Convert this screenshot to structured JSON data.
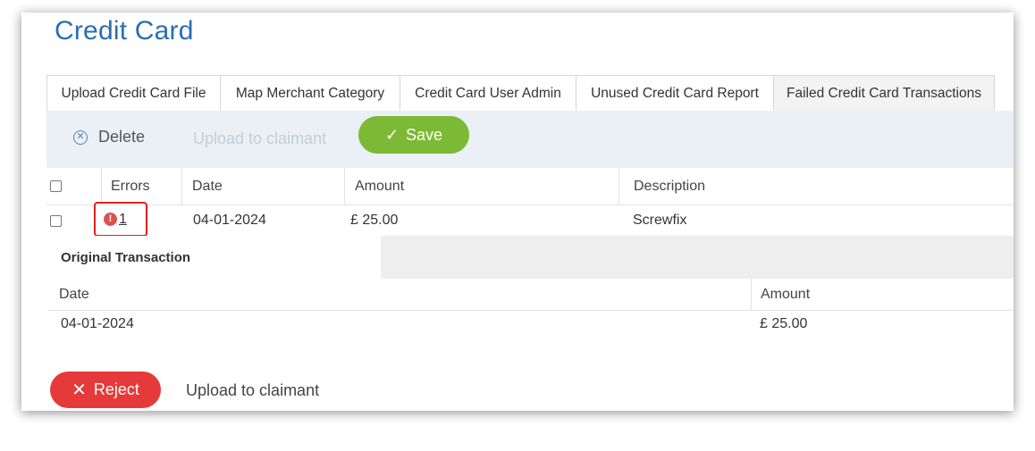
{
  "page": {
    "title": "Credit Card"
  },
  "tabs": [
    {
      "label": "Upload Credit Card File"
    },
    {
      "label": "Map Merchant Category"
    },
    {
      "label": "Credit Card User Admin"
    },
    {
      "label": "Unused Credit Card Report"
    },
    {
      "label": "Failed Credit Card Transactions",
      "active": true
    }
  ],
  "toolbar": {
    "delete_label": "Delete",
    "delete_icon": "circle-x-icon",
    "upload_label": "Upload to claimant",
    "save_label": "Save",
    "save_icon": "check-icon",
    "save_color": "#7cba36"
  },
  "grid": {
    "headers": {
      "errors": "Errors",
      "date": "Date",
      "amount": "Amount",
      "description": "Description"
    },
    "rows": [
      {
        "errors": "1",
        "error_icon": "exclamation-icon",
        "date": "04-01-2024",
        "amount": "£ 25.00",
        "description": "Screwfix"
      }
    ]
  },
  "detail": {
    "tab_label": "Original Transaction",
    "headers": {
      "date": "Date",
      "amount": "Amount"
    },
    "row": {
      "date": "04-01-2024",
      "amount": "£ 25.00"
    }
  },
  "actions": {
    "reject_label": "Reject",
    "reject_color": "#e63a3a",
    "upload_label": "Upload to claimant"
  }
}
